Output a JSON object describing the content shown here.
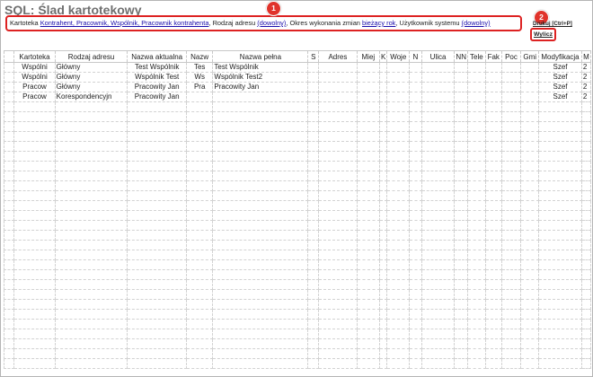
{
  "title": "SQL: Ślad kartotekowy",
  "filter": {
    "kartoteka_label": "Kartoteka",
    "kartoteka_value": "Kontrahent, Pracownik, Wspólnik, Pracownik kontrahenta",
    "sep1": ",",
    "rodzaj_label": "Rodzaj adresu",
    "rodzaj_value": "(dowolny)",
    "sep2": ",",
    "okres_label": "Okres wykonania zmian",
    "okres_value": "bieżący rok",
    "sep3": ",",
    "uzytkownik_label": "Użytkownik systemu",
    "uzytkownik_value": "(dowolny)"
  },
  "badges": [
    "1",
    "2"
  ],
  "toolbar": {
    "shortcut_label": "Drukuj [Ctrl+P]",
    "compute_label": "Wylicz"
  },
  "grid": {
    "headers": [
      "Kartoteka",
      "Rodzaj adresu",
      "Nazwa aktualna",
      "Nazw",
      "Nazwa pełna",
      "S",
      "Adres",
      "Miej",
      "K",
      "Woje",
      "N",
      "Ulica",
      "NN",
      "Tele",
      "Fak",
      "Poc",
      "Gmi",
      "Modyfikacja",
      "M"
    ],
    "rows": [
      [
        "Wspólni",
        "Główny",
        "Test Wspólnik",
        "Tes",
        "Test Wspólnik",
        "",
        "",
        "",
        "",
        "",
        "",
        "",
        "",
        "",
        "",
        "",
        "",
        "Szef",
        "2"
      ],
      [
        "Wspólni",
        "Główny",
        "Wspólnik Test",
        "Ws",
        "Wspólnik Test2",
        "",
        "",
        "",
        "",
        "",
        "",
        "",
        "",
        "",
        "",
        "",
        "",
        "Szef",
        "2"
      ],
      [
        "Pracow",
        "Główny",
        "Pracowity Jan",
        "Pra",
        "Pracowity Jan",
        "",
        "",
        "",
        "",
        "",
        "",
        "",
        "",
        "",
        "",
        "",
        "",
        "Szef",
        "2"
      ],
      [
        "Pracow",
        "Korespondencyjn",
        "Pracowity Jan",
        "",
        "",
        "",
        "",
        "",
        "",
        "",
        "",
        "",
        "",
        "",
        "",
        "",
        "",
        "Szef",
        "2"
      ]
    ],
    "empty_rows": 27
  }
}
